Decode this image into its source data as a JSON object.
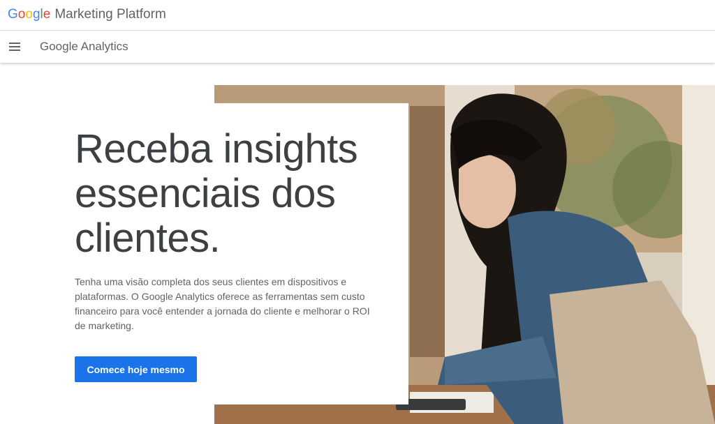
{
  "brand": {
    "google_letters": [
      "G",
      "o",
      "o",
      "g",
      "l",
      "e"
    ],
    "platform": "Marketing Platform"
  },
  "product_nav": {
    "menu_icon": "hamburger-menu-icon",
    "product_name": "Google Analytics"
  },
  "hero": {
    "headline": "Receba insights essenciais dos clientes.",
    "body": "Tenha uma visão completa dos seus clientes em dispositivos e plataformas. O Google Analytics oferece as ferramentas sem custo financeiro para você entender a jornada do cliente e melhorar o ROI de marketing.",
    "cta_label": "Comece hoje mesmo",
    "image": "woman-at-laptop-photo"
  },
  "colors": {
    "cta_background": "#1a73e8",
    "headline_text": "#3c4043",
    "body_text": "#5f6368"
  }
}
